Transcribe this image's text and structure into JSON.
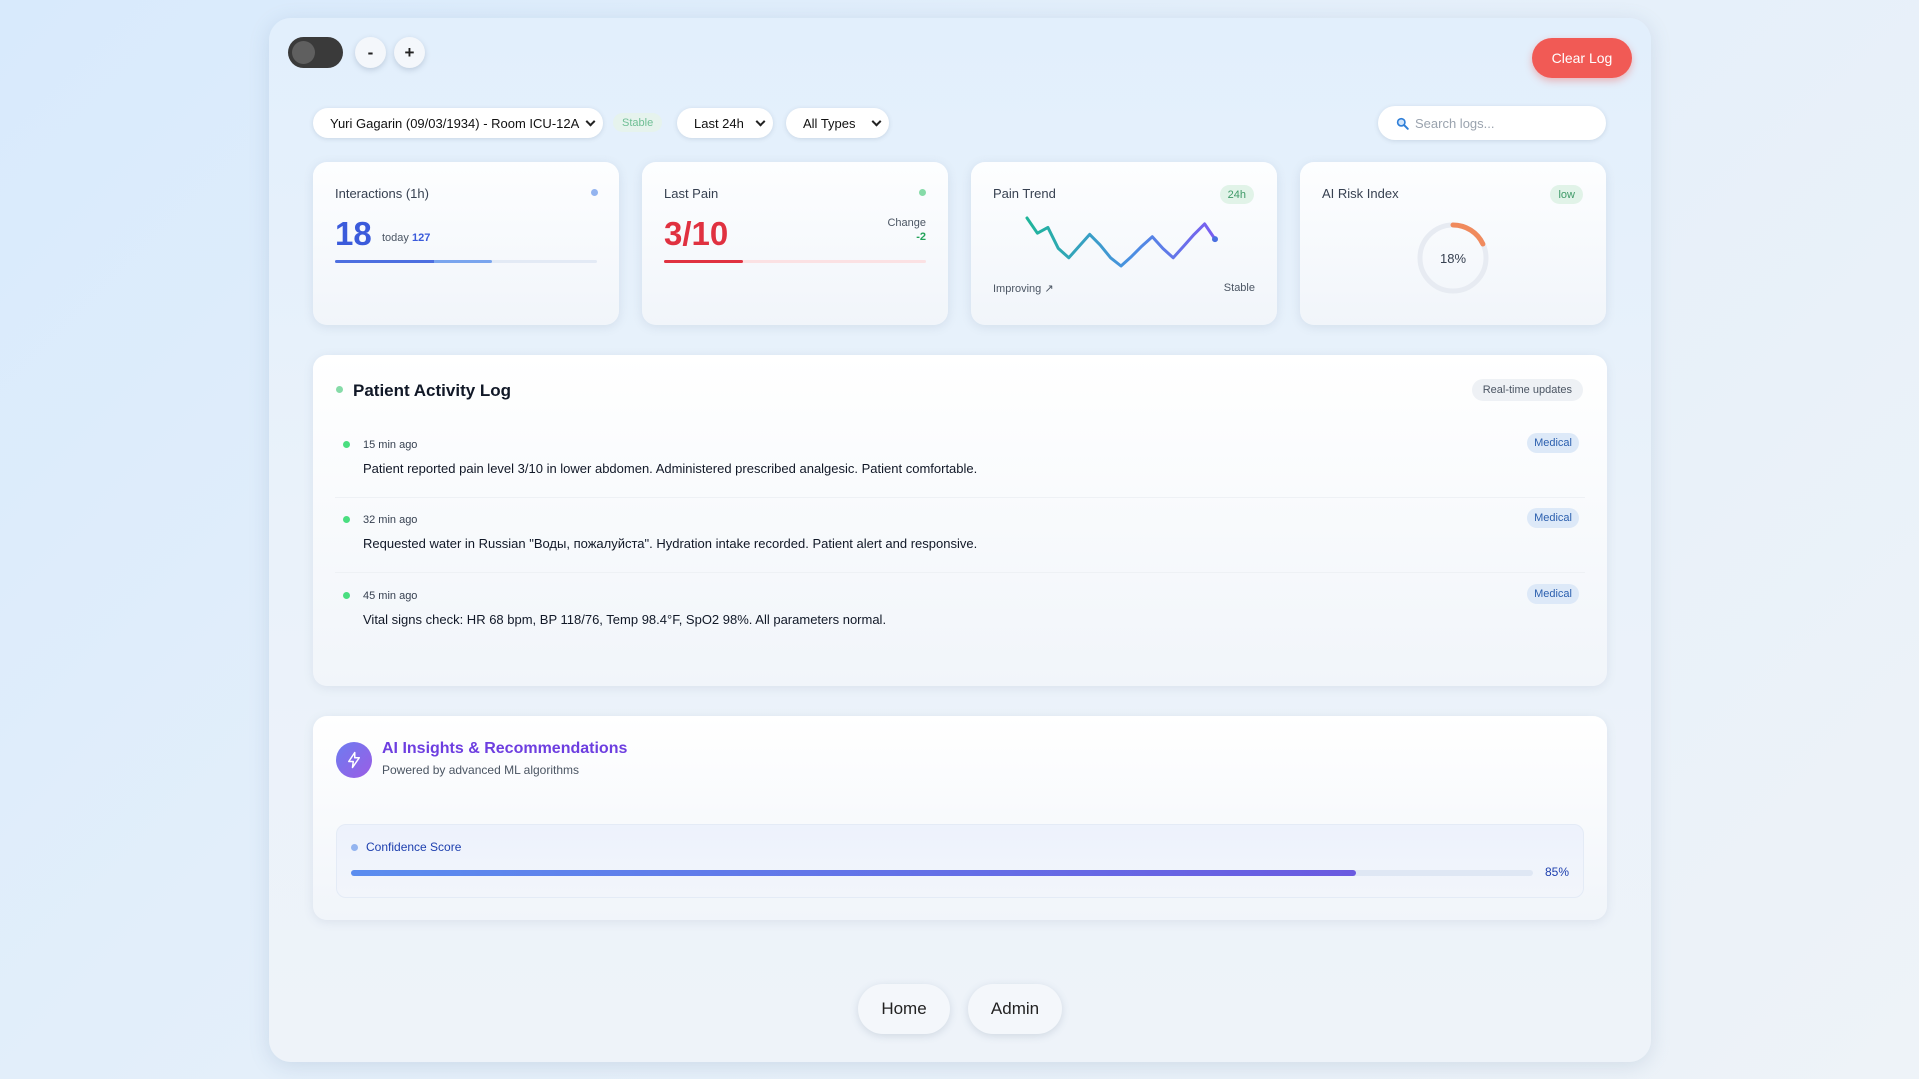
{
  "toolbar": {
    "zoom_out_label": "-",
    "zoom_in_label": "+",
    "clear_label": "Clear Log"
  },
  "filters": {
    "patient": "Yuri Gagarin (09/03/1934) - Room ICU-12A",
    "status_badge": "Stable",
    "range": "Last 24h",
    "types": "All Types",
    "search_placeholder": "Search logs..."
  },
  "cards": {
    "interactions": {
      "title": "Interactions (1h)",
      "value": "18",
      "today_label": "today",
      "today_value": "127",
      "progress": 0.6
    },
    "pain": {
      "title": "Last Pain",
      "value": "3/10",
      "change_label": "Change",
      "change_value": "-2",
      "progress": 0.3
    },
    "trend": {
      "title": "Pain Trend",
      "badge": "24h",
      "left_label": "Improving ↗",
      "right_label": "Stable",
      "points": [
        6,
        4.7,
        5.2,
        3.4,
        2.6,
        3.6,
        4.6,
        3.7,
        2.6,
        1.9,
        2.7,
        3.6,
        4.4,
        3.4,
        2.6,
        3.6,
        4.6,
        5.5,
        4.2
      ]
    },
    "risk": {
      "title": "AI Risk Index",
      "badge": "low",
      "value_label": "18%",
      "value": 0.18
    }
  },
  "log": {
    "title": "Patient Activity Log",
    "badge": "Real-time updates",
    "items": [
      {
        "time": "15 min ago",
        "text": "Patient reported pain level 3/10 in lower abdomen. Administered prescribed analgesic. Patient comfortable.",
        "tag": "Medical"
      },
      {
        "time": "32 min ago",
        "text": "Requested water in Russian \"Воды, пожалуйста\". Hydration intake recorded. Patient alert and responsive.",
        "tag": "Medical"
      },
      {
        "time": "45 min ago",
        "text": "Vital signs check: HR 68 bpm, BP 118/76, Temp 98.4°F, SpO2 98%. All parameters normal.",
        "tag": "Medical"
      }
    ]
  },
  "insights": {
    "title": "AI Insights & Recommendations",
    "subtitle": "Powered by advanced ML algorithms",
    "confidence_label": "Confidence Score",
    "confidence_value": "85%",
    "confidence": 0.85
  },
  "nav": {
    "home": "Home",
    "admin": "Admin"
  },
  "colors": {
    "accent_blue": "#3b5bdb",
    "pain_red": "#e03140",
    "clear_red": "#f15a55",
    "success_green": "#4ade80",
    "ai_purple": "#6d3ee0"
  }
}
